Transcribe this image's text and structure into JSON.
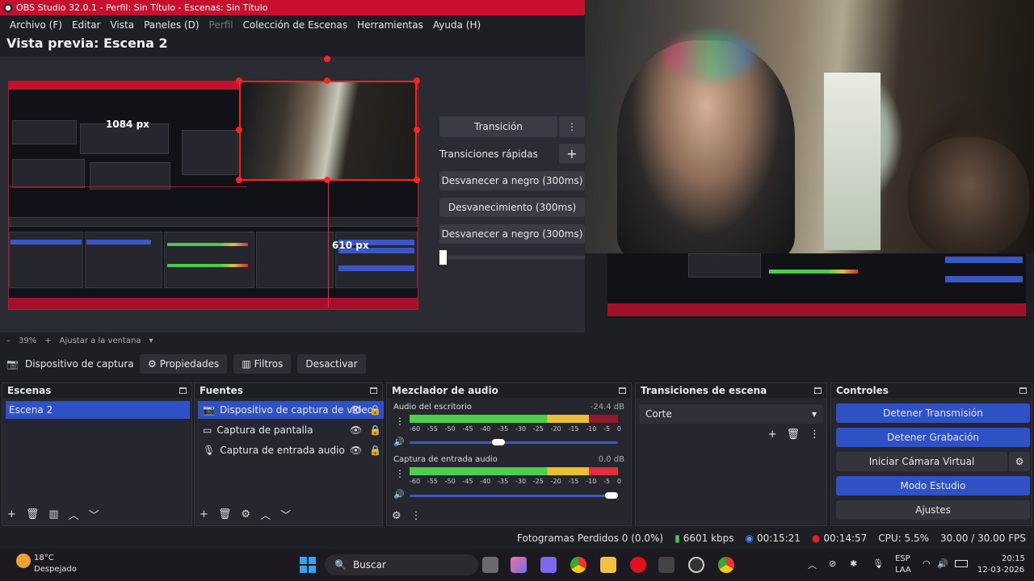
{
  "window": {
    "title": "OBS Studio 32.0.1 - Perfil: Sin Título - Escenas: Sin Título"
  },
  "menu": [
    "Archivo (F)",
    "Editar",
    "Vista",
    "Paneles (D)",
    "Perfil",
    "Colección de Escenas",
    "Herramientas",
    "Ayuda (H)"
  ],
  "preview": {
    "title": "Vista previa: Escena 2",
    "width_label": "1084 px",
    "height_label": "610 px",
    "zoom": "39%",
    "fit_label": "Ajustar a la ventana",
    "minus": "–",
    "plus": "+"
  },
  "transition_panel": {
    "transition_btn": "Transición",
    "quick_label": "Transiciones rápidas",
    "items": [
      "Desvanecer a negro (300ms)",
      "Desvanecimiento (300ms)",
      "Desvanecer a negro (300ms)"
    ]
  },
  "source_toolbar": {
    "selected_source": "Dispositivo de captura de v",
    "properties": "Propiedades",
    "filters": "Filtros",
    "deactivate": "Desactivar"
  },
  "docks": {
    "scenes": {
      "title": "Escenas",
      "items": [
        "Escena 2"
      ]
    },
    "sources": {
      "title": "Fuentes",
      "items": [
        "Dispositivo de captura de video",
        "Captura de pantalla",
        "Captura de entrada audio"
      ]
    },
    "mixer": {
      "title": "Mezclador de audio",
      "ticks": [
        "-60",
        "-55",
        "-50",
        "-45",
        "-40",
        "-35",
        "-30",
        "-25",
        "-20",
        "-15",
        "-10",
        "-5",
        "0"
      ],
      "channels": [
        {
          "name": "Audio del escritorio",
          "db": "-24.4 dB",
          "level": 0.86,
          "volume": 0.42
        },
        {
          "name": "Captura de entrada audio",
          "db": "0.0 dB",
          "level": 1.0,
          "volume": 1.0
        }
      ]
    },
    "scene_transitions": {
      "title": "Transiciones de escena",
      "selected": "Corte"
    },
    "controls": {
      "title": "Controles",
      "buttons": [
        "Detener Transmisión",
        "Detener Grabación",
        "Iniciar Cámara Virtual",
        "Modo Estudio",
        "Ajustes"
      ]
    }
  },
  "status": {
    "dropped": "Fotogramas Perdidos 0 (0.0%)",
    "bitrate": "6601 kbps",
    "stream_time": "00:15:21",
    "rec_time": "00:14:57",
    "cpu": "CPU: 5.5%",
    "fps": "30.00 / 30.00 FPS"
  },
  "taskbar": {
    "temp": "18°C",
    "weather": "Despejado",
    "search": "Buscar",
    "lang1": "ESP",
    "lang2": "LAA",
    "time": "20:15",
    "date": "12-03-2026"
  },
  "colors": {
    "accent": "#2f51c6",
    "title_red": "#c8102e",
    "bg": "#1e1f24"
  }
}
